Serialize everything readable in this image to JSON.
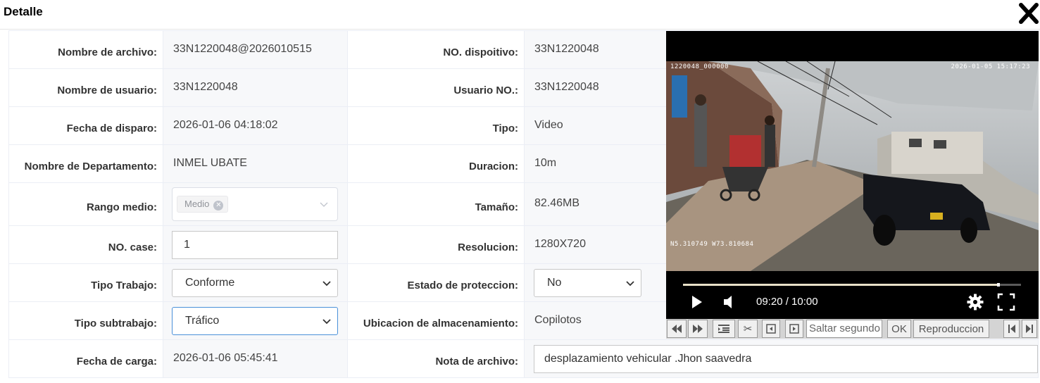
{
  "dialog": {
    "title": "Detalle",
    "close_icon": "close-icon"
  },
  "left": [
    {
      "label": "Nombre de archivo:",
      "value": "33N1220048@2026010515"
    },
    {
      "label": "Nombre de usuario:",
      "value": "33N1220048"
    },
    {
      "label": "Fecha de disparo:",
      "value": "2026-01-06 04:18:02"
    },
    {
      "label": "Nombre de Departamento:",
      "value": "INMEL UBATE"
    },
    {
      "label": "Rango medio:",
      "value": "Medio"
    },
    {
      "label": "NO. case:",
      "value": "1"
    },
    {
      "label": "Tipo Trabajo:",
      "value": "Conforme"
    },
    {
      "label": "Tipo subtrabajo:",
      "value": "Tráfico"
    },
    {
      "label": "Fecha de carga:",
      "value": "2026-01-06 05:45:41"
    }
  ],
  "right": [
    {
      "label": "NO. dispoitivo:",
      "value": "33N1220048"
    },
    {
      "label": "Usuario NO.:",
      "value": "33N1220048"
    },
    {
      "label": "Tipo:",
      "value": "Video"
    },
    {
      "label": "Duracion:",
      "value": "10m"
    },
    {
      "label": "Tamaño:",
      "value": "82.46MB"
    },
    {
      "label": "Resolucion:",
      "value": "1280X720"
    },
    {
      "label": "Estado de proteccion:",
      "value": "No"
    },
    {
      "label": "Ubicacion de almacenamiento:",
      "value": "Copilotos"
    },
    {
      "label": "Nota de archivo:",
      "value": "desplazamiento vehicular .Jhon saavedra"
    }
  ],
  "player": {
    "osd_id": "1220048_000000",
    "osd_datetime": "2026-01-05 15:17:23",
    "osd_gps": "N5.310749 W73.810684",
    "time": "09:20 / 10:00",
    "progress": 0.933
  },
  "toolbar": {
    "seek_placeholder": "Saltar segundo",
    "ok_label": "OK",
    "play_label": "Reproduccion"
  }
}
